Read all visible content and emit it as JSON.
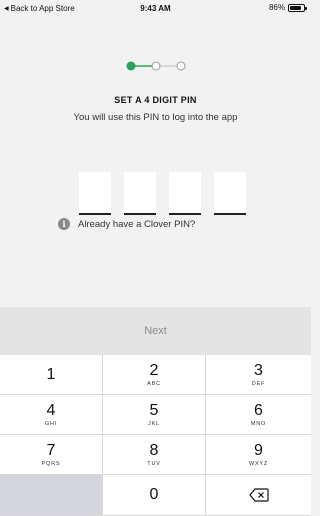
{
  "status_bar": {
    "back_label": "Back to App Store",
    "time": "9:43 AM",
    "battery_percent_label": "86%",
    "battery_level": 0.86
  },
  "steps": {
    "total": 3,
    "current": 1,
    "active_color": "#2aa35a"
  },
  "pin": {
    "title": "SET A 4 DIGIT PIN",
    "subtitle": "You will use this PIN to log into the app",
    "digit_count": 4
  },
  "hint": {
    "icon": "info-icon",
    "text": "Already have a Clover PIN?"
  },
  "next_button": {
    "label": "Next"
  },
  "keypad": {
    "keys": [
      {
        "digit": "1",
        "letters": ""
      },
      {
        "digit": "2",
        "letters": "ABC"
      },
      {
        "digit": "3",
        "letters": "DEF"
      },
      {
        "digit": "4",
        "letters": "GHI"
      },
      {
        "digit": "5",
        "letters": "JKL"
      },
      {
        "digit": "6",
        "letters": "MNO"
      },
      {
        "digit": "7",
        "letters": "PQRS"
      },
      {
        "digit": "8",
        "letters": "TUV"
      },
      {
        "digit": "9",
        "letters": "WXYZ"
      },
      {
        "digit": "0",
        "letters": ""
      }
    ],
    "delete_icon": "backspace-icon"
  }
}
